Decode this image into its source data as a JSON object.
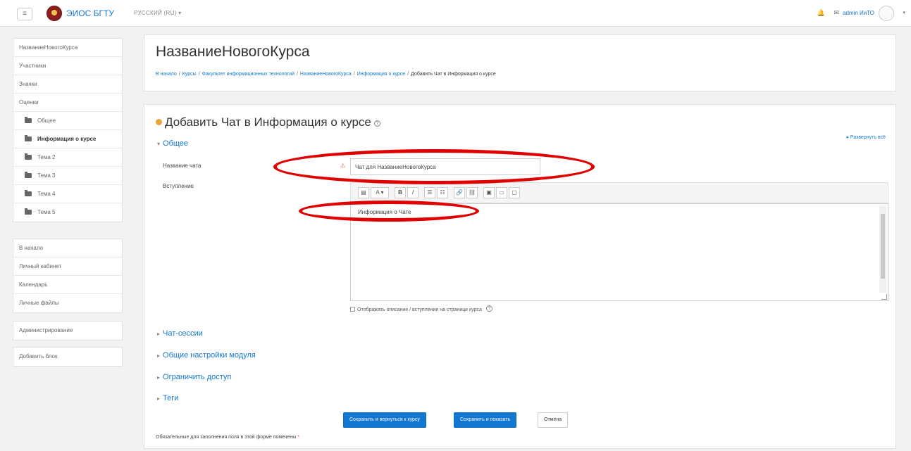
{
  "navbar": {
    "menu_icon": "hamburger-icon",
    "site_name": "ЭИОС БГТУ",
    "language": "РУССКИЙ (RU) ▾",
    "user_name": "admin ИиТО",
    "avatar_caret": "▾"
  },
  "sidebar": {
    "course_block": [
      {
        "label": "НазваниеНовогоКурса"
      },
      {
        "label": "Участники"
      },
      {
        "label": "Значки"
      },
      {
        "label": "Оценки"
      },
      {
        "label": "Общее"
      },
      {
        "label": "Информация о курсе"
      },
      {
        "label": "Тема 2"
      },
      {
        "label": "Тема 3"
      },
      {
        "label": "Тема 4"
      },
      {
        "label": "Тема 5"
      }
    ],
    "nav_block": [
      {
        "label": "В начало"
      },
      {
        "label": "Личный кабинет"
      },
      {
        "label": "Календарь"
      },
      {
        "label": "Личные файлы"
      }
    ],
    "admin_block": {
      "label": "Администрирование"
    },
    "add_block": {
      "label": "Добавить блок"
    }
  },
  "header": {
    "title": "НазваниеНовогоКурса",
    "breadcrumb": [
      "В начало",
      "Курсы",
      "Факультет информационных технологий",
      "НазваниеНовогоКурса",
      "Информация о курсе",
      "Добавить Чат в Информация о курсе"
    ],
    "breadcrumb_sep": "/"
  },
  "form": {
    "title": "Добавить Чат в Информация о курсе",
    "help_glyph": "?",
    "expand_all": "▸ Развернуть всё",
    "section_general": "Общее",
    "chat_name_label": "Название чата",
    "required_glyph": "⚠",
    "chat_name_value": "Чат для НазваниеНовогоКурса",
    "intro_label": "Вступление",
    "toolbar": [
      "▤",
      "A ▾",
      "B",
      "I",
      "☰",
      "☷",
      "🔗",
      "⛓",
      "▣",
      "▭",
      "▢"
    ],
    "intro_text": "Информация о Чате",
    "show_description_label": "Отображать описание / вступление на странице курса",
    "sections": [
      "Чат-сессии",
      "Общие настройки модуля",
      "Ограничить доступ",
      "Теги"
    ],
    "collapsed_arrow": "▸",
    "expanded_arrow": "▾",
    "buttons": {
      "save_return": "Сохранить и вернуться к курсу",
      "save_display": "Сохранить и показать",
      "cancel": "Отмена"
    },
    "required_note": "Обязательные для заполнения поля в этой форме помечены",
    "required_star": "*"
  },
  "colors": {
    "accent": "#1177d1",
    "highlight_ellipse": "#e00000"
  }
}
